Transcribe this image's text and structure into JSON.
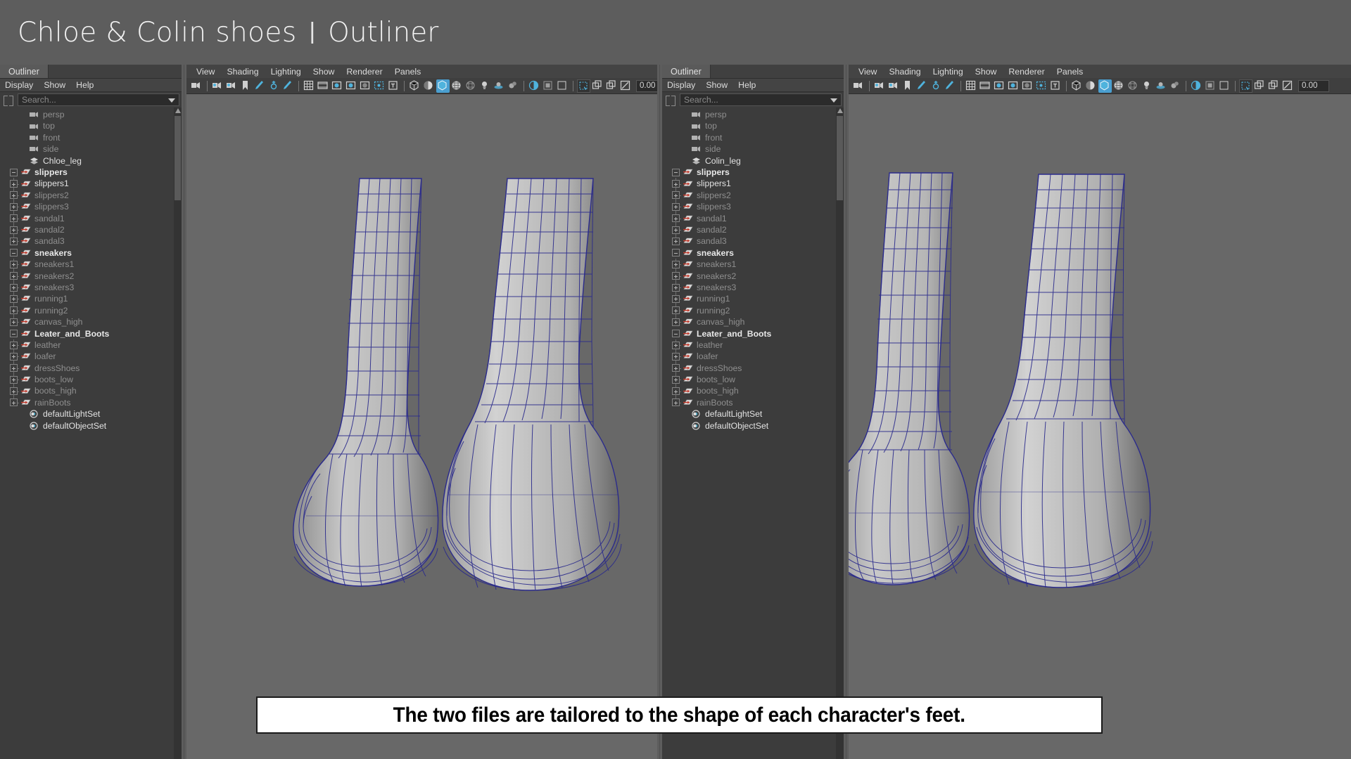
{
  "header": {
    "title": "Chloe & Colin shoes",
    "separator": "|",
    "subtitle": "Outliner"
  },
  "caption": {
    "text": "The two files are tailored to the shape of each character's feet."
  },
  "outliner_left": {
    "tab_label": "Outliner",
    "menus": [
      "Display",
      "Show",
      "Help"
    ],
    "search_placeholder": "Search...",
    "search_value": "",
    "tree": [
      {
        "label": "persp",
        "icon": "camera-icon",
        "level": 1,
        "state": "dim",
        "expander": "none"
      },
      {
        "label": "top",
        "icon": "camera-icon",
        "level": 1,
        "state": "dim",
        "expander": "none"
      },
      {
        "label": "front",
        "icon": "camera-icon",
        "level": 1,
        "state": "dim",
        "expander": "none"
      },
      {
        "label": "side",
        "icon": "camera-icon",
        "level": 1,
        "state": "dim",
        "expander": "none"
      },
      {
        "label": "Chloe_leg",
        "icon": "mesh-icon",
        "level": 1,
        "state": "lit",
        "expander": "none"
      },
      {
        "label": "slippers",
        "icon": "group-icon",
        "level": 0,
        "state": "bold",
        "expander": "minus"
      },
      {
        "label": "slippers1",
        "icon": "group-icon",
        "level": 1,
        "state": "lit",
        "expander": "plus"
      },
      {
        "label": "slippers2",
        "icon": "group-icon",
        "level": 1,
        "state": "dim",
        "expander": "plus"
      },
      {
        "label": "slippers3",
        "icon": "group-icon",
        "level": 1,
        "state": "dim",
        "expander": "plus"
      },
      {
        "label": "sandal1",
        "icon": "group-icon",
        "level": 1,
        "state": "dim",
        "expander": "plus"
      },
      {
        "label": "sandal2",
        "icon": "group-icon",
        "level": 1,
        "state": "dim",
        "expander": "plus"
      },
      {
        "label": "sandal3",
        "icon": "group-icon",
        "level": 1,
        "state": "dim",
        "expander": "plus",
        "last": true
      },
      {
        "label": "sneakers",
        "icon": "group-icon",
        "level": 0,
        "state": "bold",
        "expander": "minus"
      },
      {
        "label": "sneakers1",
        "icon": "group-icon",
        "level": 1,
        "state": "dim",
        "expander": "plus"
      },
      {
        "label": "sneakers2",
        "icon": "group-icon",
        "level": 1,
        "state": "dim",
        "expander": "plus"
      },
      {
        "label": "sneakers3",
        "icon": "group-icon",
        "level": 1,
        "state": "dim",
        "expander": "plus"
      },
      {
        "label": "running1",
        "icon": "group-icon",
        "level": 1,
        "state": "dim",
        "expander": "plus"
      },
      {
        "label": "running2",
        "icon": "group-icon",
        "level": 1,
        "state": "dim",
        "expander": "plus"
      },
      {
        "label": "canvas_high",
        "icon": "group-icon",
        "level": 1,
        "state": "dim",
        "expander": "plus",
        "last": true
      },
      {
        "label": "Leater_and_Boots",
        "icon": "group-icon",
        "level": 0,
        "state": "bold",
        "expander": "minus"
      },
      {
        "label": "leather",
        "icon": "group-icon",
        "level": 1,
        "state": "dim",
        "expander": "plus"
      },
      {
        "label": "loafer",
        "icon": "group-icon",
        "level": 1,
        "state": "dim",
        "expander": "plus"
      },
      {
        "label": "dressShoes",
        "icon": "group-icon",
        "level": 1,
        "state": "dim",
        "expander": "plus"
      },
      {
        "label": "boots_low",
        "icon": "group-icon",
        "level": 1,
        "state": "dim",
        "expander": "plus"
      },
      {
        "label": "boots_high",
        "icon": "group-icon",
        "level": 1,
        "state": "dim",
        "expander": "plus"
      },
      {
        "label": "rainBoots",
        "icon": "group-icon",
        "level": 1,
        "state": "dim",
        "expander": "plus",
        "last": true
      },
      {
        "label": "defaultLightSet",
        "icon": "set-icon",
        "level": 1,
        "state": "lit",
        "expander": "none"
      },
      {
        "label": "defaultObjectSet",
        "icon": "set-icon",
        "level": 1,
        "state": "lit",
        "expander": "none"
      }
    ]
  },
  "outliner_right": {
    "tab_label": "Outliner",
    "menus": [
      "Display",
      "Show",
      "Help"
    ],
    "search_placeholder": "Search...",
    "search_value": "",
    "tree": [
      {
        "label": "persp",
        "icon": "camera-icon",
        "level": 1,
        "state": "dim",
        "expander": "none"
      },
      {
        "label": "top",
        "icon": "camera-icon",
        "level": 1,
        "state": "dim",
        "expander": "none"
      },
      {
        "label": "front",
        "icon": "camera-icon",
        "level": 1,
        "state": "dim",
        "expander": "none"
      },
      {
        "label": "side",
        "icon": "camera-icon",
        "level": 1,
        "state": "dim",
        "expander": "none"
      },
      {
        "label": "Colin_leg",
        "icon": "mesh-icon",
        "level": 1,
        "state": "lit",
        "expander": "none"
      },
      {
        "label": "slippers",
        "icon": "group-icon",
        "level": 0,
        "state": "bold",
        "expander": "minus"
      },
      {
        "label": "slippers1",
        "icon": "group-icon",
        "level": 1,
        "state": "lit",
        "expander": "plus"
      },
      {
        "label": "slippers2",
        "icon": "group-icon",
        "level": 1,
        "state": "dim",
        "expander": "plus"
      },
      {
        "label": "slippers3",
        "icon": "group-icon",
        "level": 1,
        "state": "dim",
        "expander": "plus"
      },
      {
        "label": "sandal1",
        "icon": "group-icon",
        "level": 1,
        "state": "dim",
        "expander": "plus"
      },
      {
        "label": "sandal2",
        "icon": "group-icon",
        "level": 1,
        "state": "dim",
        "expander": "plus"
      },
      {
        "label": "sandal3",
        "icon": "group-icon",
        "level": 1,
        "state": "dim",
        "expander": "plus",
        "last": true
      },
      {
        "label": "sneakers",
        "icon": "group-icon",
        "level": 0,
        "state": "bold",
        "expander": "minus"
      },
      {
        "label": "sneakers1",
        "icon": "group-icon",
        "level": 1,
        "state": "dim",
        "expander": "plus"
      },
      {
        "label": "sneakers2",
        "icon": "group-icon",
        "level": 1,
        "state": "dim",
        "expander": "plus"
      },
      {
        "label": "sneakers3",
        "icon": "group-icon",
        "level": 1,
        "state": "dim",
        "expander": "plus"
      },
      {
        "label": "running1",
        "icon": "group-icon",
        "level": 1,
        "state": "dim",
        "expander": "plus"
      },
      {
        "label": "running2",
        "icon": "group-icon",
        "level": 1,
        "state": "dim",
        "expander": "plus"
      },
      {
        "label": "canvas_high",
        "icon": "group-icon",
        "level": 1,
        "state": "dim",
        "expander": "plus",
        "last": true
      },
      {
        "label": "Leater_and_Boots",
        "icon": "group-icon",
        "level": 0,
        "state": "bold",
        "expander": "minus"
      },
      {
        "label": "leather",
        "icon": "group-icon",
        "level": 1,
        "state": "dim",
        "expander": "plus"
      },
      {
        "label": "loafer",
        "icon": "group-icon",
        "level": 1,
        "state": "dim",
        "expander": "plus"
      },
      {
        "label": "dressShoes",
        "icon": "group-icon",
        "level": 1,
        "state": "dim",
        "expander": "plus"
      },
      {
        "label": "boots_low",
        "icon": "group-icon",
        "level": 1,
        "state": "dim",
        "expander": "plus"
      },
      {
        "label": "boots_high",
        "icon": "group-icon",
        "level": 1,
        "state": "dim",
        "expander": "plus"
      },
      {
        "label": "rainBoots",
        "icon": "group-icon",
        "level": 1,
        "state": "dim",
        "expander": "plus",
        "last": true
      },
      {
        "label": "defaultLightSet",
        "icon": "set-icon",
        "level": 1,
        "state": "lit",
        "expander": "none"
      },
      {
        "label": "defaultObjectSet",
        "icon": "set-icon",
        "level": 1,
        "state": "lit",
        "expander": "none"
      }
    ]
  },
  "viewport_left": {
    "menus": [
      "View",
      "Shading",
      "Lighting",
      "Show",
      "Renderer",
      "Panels"
    ],
    "exposure_value": "0.00",
    "toolbar_icons": [
      "camera-icon",
      "camera-lock-icon",
      "camera-attributes-icon",
      "bookmark-icon",
      "grease-pencil-icon",
      "add-key-icon",
      "eraser-icon",
      "grid-icon",
      "film-gate-icon",
      "resolution-gate-icon",
      "field-chart-icon",
      "safe-action-icon",
      "safe-title-icon",
      "text-icon",
      "wireframe-icon",
      "smooth-shade-icon",
      "flat-shade-icon",
      "shaded-textured-icon",
      "wireframe-on-shaded-icon",
      "lights-icon",
      "shadows-icon",
      "occlusion-icon",
      "antialias-icon",
      "multisample-icon",
      "depth-peel-icon",
      "xray-icon",
      "xray-joints-icon",
      "isolate-select-icon",
      "exposure-icon"
    ]
  },
  "viewport_right": {
    "menus": [
      "View",
      "Shading",
      "Lighting",
      "Show",
      "Renderer",
      "Panels"
    ],
    "exposure_value": "0.00"
  }
}
